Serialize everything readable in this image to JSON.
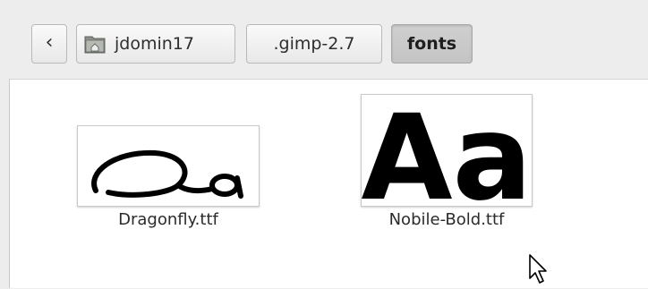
{
  "pathbar": {
    "back_glyph": "‹",
    "segments": [
      {
        "label": "jdomin17",
        "icon": "home-folder-icon"
      },
      {
        "label": ".gimp-2.7"
      },
      {
        "label": "fonts",
        "active": true
      }
    ]
  },
  "files": [
    {
      "name": "Dragonfly.ttf",
      "preview": "Aa",
      "icon": "font-preview-script"
    },
    {
      "name": "Nobile-Bold.ttf",
      "preview": "Aa",
      "icon": "font-preview-bold"
    }
  ]
}
